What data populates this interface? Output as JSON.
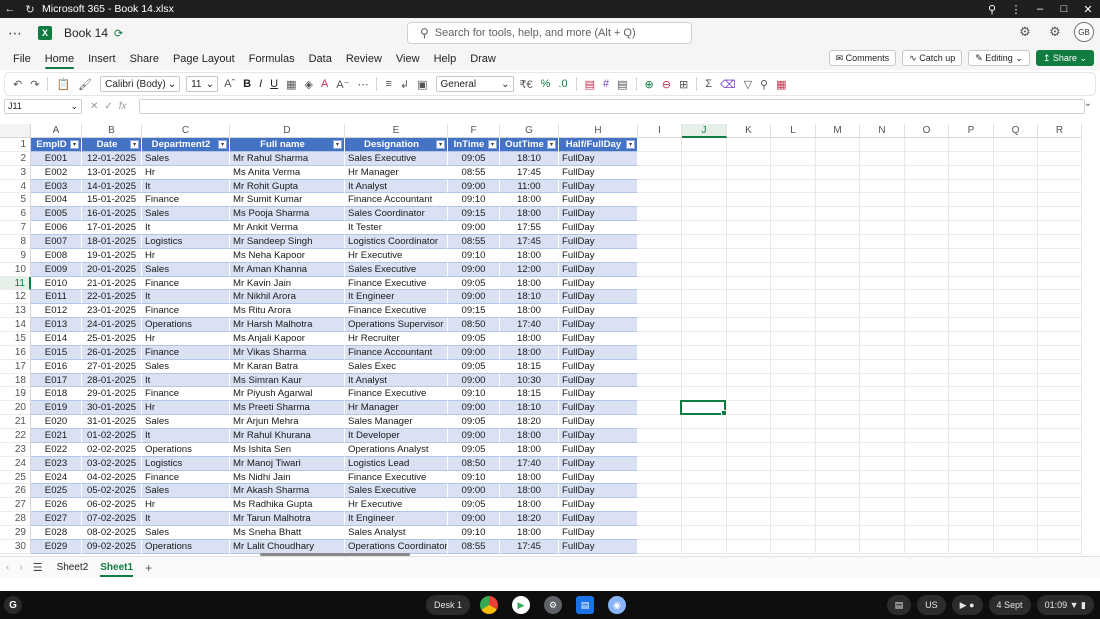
{
  "browser": {
    "title": "Microsoft 365 - Book 14.xlsx",
    "icons": [
      "back-arrow-icon",
      "reload-icon",
      "zoom-icon",
      "more-vert-icon",
      "minimize-icon",
      "maximize-icon",
      "close-icon"
    ]
  },
  "header": {
    "doc_title": "Book 14",
    "search_placeholder": "Search for tools, help, and more (Alt + Q)",
    "avatar_initials": "GB"
  },
  "menu": {
    "tabs": [
      "File",
      "Home",
      "Insert",
      "Share",
      "Page Layout",
      "Formulas",
      "Data",
      "Review",
      "View",
      "Help",
      "Draw"
    ],
    "active_tab": "Home",
    "comments_label": "Comments",
    "catchup_label": "Catch up",
    "editing_label": "Editing",
    "share_label": "Share"
  },
  "ribbon": {
    "font_name": "Calibri (Body)",
    "font_size": "11",
    "number_format": "General"
  },
  "formula_bar": {
    "name_box": "J11",
    "fx": "fx",
    "value": ""
  },
  "grid": {
    "columns": [
      "A",
      "B",
      "C",
      "D",
      "E",
      "F",
      "G",
      "H",
      "I",
      "J",
      "K",
      "L",
      "M",
      "N",
      "O",
      "P",
      "Q",
      "R"
    ],
    "selected_column": "J",
    "selected_row": 11,
    "headers": [
      "EmpID",
      "Date",
      "Department2",
      "Full name",
      "Designation",
      "InTime",
      "OutTime",
      "Half/FullDay"
    ],
    "rows": [
      [
        "E001",
        "12-01-2025",
        "Sales",
        "Mr Rahul Sharma",
        "Sales Executive",
        "09:05",
        "18:10",
        "FullDay"
      ],
      [
        "E002",
        "13-01-2025",
        "Hr",
        "Ms Anita Verma",
        "Hr Manager",
        "08:55",
        "17:45",
        "FullDay"
      ],
      [
        "E003",
        "14-01-2025",
        "It",
        "Mr Rohit Gupta",
        "It Analyst",
        "09:00",
        "11:00",
        "FullDay"
      ],
      [
        "E004",
        "15-01-2025",
        "Finance",
        "Mr Sumit Kumar",
        "Finance Accountant",
        "09:10",
        "18:00",
        "FullDay"
      ],
      [
        "E005",
        "16-01-2025",
        "Sales",
        "Ms Pooja Sharma",
        "Sales Coordinator",
        "09:15",
        "18:00",
        "FullDay"
      ],
      [
        "E006",
        "17-01-2025",
        "It",
        "Mr Ankit Verma",
        "It Tester",
        "09:00",
        "17:55",
        "FullDay"
      ],
      [
        "E007",
        "18-01-2025",
        "Logistics",
        "Mr Sandeep Singh",
        "Logistics Coordinator",
        "08:55",
        "17:45",
        "FullDay"
      ],
      [
        "E008",
        "19-01-2025",
        "Hr",
        "Ms Neha Kapoor",
        "Hr Executive",
        "09:10",
        "18:00",
        "FullDay"
      ],
      [
        "E009",
        "20-01-2025",
        "Sales",
        "Mr Aman Khanna",
        "Sales Executive",
        "09:00",
        "12:00",
        "FullDay"
      ],
      [
        "E010",
        "21-01-2025",
        "Finance",
        "Mr Kavin Jain",
        "Finance Executive",
        "09:05",
        "18:00",
        "FullDay"
      ],
      [
        "E011",
        "22-01-2025",
        "It",
        "Mr Nikhil Arora",
        "It Engineer",
        "09:00",
        "18:10",
        "FullDay"
      ],
      [
        "E012",
        "23-01-2025",
        "Finance",
        "Ms Ritu Arora",
        "Finance Executive",
        "09:15",
        "18:00",
        "FullDay"
      ],
      [
        "E013",
        "24-01-2025",
        "Operations",
        "Mr Harsh Malhotra",
        "Operations Supervisor",
        "08:50",
        "17:40",
        "FullDay"
      ],
      [
        "E014",
        "25-01-2025",
        "Hr",
        "Ms Anjali Kapoor",
        "Hr Recruiter",
        "09:05",
        "18:00",
        "FullDay"
      ],
      [
        "E015",
        "26-01-2025",
        "Finance",
        "Mr Vikas Sharma",
        "Finance Accountant",
        "09:00",
        "18:00",
        "FullDay"
      ],
      [
        "E016",
        "27-01-2025",
        "Sales",
        "Mr Karan Batra",
        "Sales Exec",
        "09:05",
        "18:15",
        "FullDay"
      ],
      [
        "E017",
        "28-01-2025",
        "It",
        "Ms Simran Kaur",
        "It Analyst",
        "09:00",
        "10:30",
        "FullDay"
      ],
      [
        "E018",
        "29-01-2025",
        "Finance",
        "Mr Piyush Agarwal",
        "Finance Executive",
        "09:10",
        "18:15",
        "FullDay"
      ],
      [
        "E019",
        "30-01-2025",
        "Hr",
        "Ms Preeti Sharma",
        "Hr Manager",
        "09:00",
        "18:10",
        "FullDay"
      ],
      [
        "E020",
        "31-01-2025",
        "Sales",
        "Mr Arjun Mehra",
        "Sales Manager",
        "09:05",
        "18:20",
        "FullDay"
      ],
      [
        "E021",
        "01-02-2025",
        "It",
        "Mr Rahul Khurana",
        "It Developer",
        "09:00",
        "18:00",
        "FullDay"
      ],
      [
        "E022",
        "02-02-2025",
        "Operations",
        "Ms Ishita Sen",
        "Operations Analyst",
        "09:05",
        "18:00",
        "FullDay"
      ],
      [
        "E023",
        "03-02-2025",
        "Logistics",
        "Mr Manoj Tiwari",
        "Logistics Lead",
        "08:50",
        "17:40",
        "FullDay"
      ],
      [
        "E024",
        "04-02-2025",
        "Finance",
        "Ms Nidhi Jain",
        "Finance Executive",
        "09:10",
        "18:00",
        "FullDay"
      ],
      [
        "E025",
        "05-02-2025",
        "Sales",
        "Mr Akash Sharma",
        "Sales Executive",
        "09:00",
        "18:00",
        "FullDay"
      ],
      [
        "E026",
        "06-02-2025",
        "Hr",
        "Ms Radhika Gupta",
        "Hr Executive",
        "09:05",
        "18:00",
        "FullDay"
      ],
      [
        "E027",
        "07-02-2025",
        "It",
        "Mr Tarun Malhotra",
        "It Engineer",
        "09:00",
        "18:20",
        "FullDay"
      ],
      [
        "E028",
        "08-02-2025",
        "Sales",
        "Ms Sneha Bhatt",
        "Sales Analyst",
        "09:10",
        "18:00",
        "FullDay"
      ],
      [
        "E029",
        "09-02-2025",
        "Operations",
        "Mr Lalit Choudhary",
        "Operations Coordinator",
        "08:55",
        "17:45",
        "FullDay"
      ]
    ]
  },
  "sheets": {
    "tabs": [
      "Sheet2",
      "Sheet1"
    ],
    "active": "Sheet1"
  },
  "taskbar": {
    "desk_label": "Desk 1",
    "locale": "US",
    "date": "4 Sept",
    "time": "01:09"
  },
  "colors": {
    "excel_green": "#107c41",
    "table_header": "#4472c4",
    "table_band": "#d9e1f2"
  }
}
